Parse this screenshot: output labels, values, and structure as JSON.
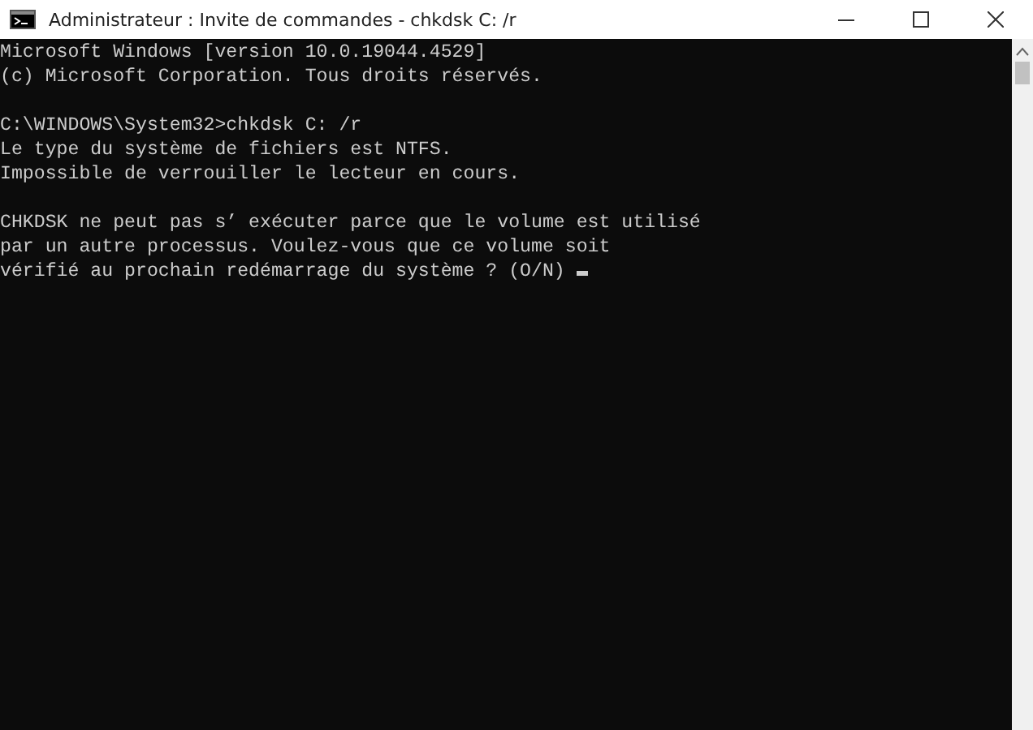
{
  "window": {
    "title": "Administrateur : Invite de commandes - chkdsk  C: /r"
  },
  "console": {
    "blocks": [
      [
        "Microsoft Windows [version 10.0.19044.4529]",
        "(c) Microsoft Corporation. Tous droits réservés."
      ],
      [
        "C:\\WINDOWS\\System32>chkdsk C: /r",
        "Le type du système de fichiers est NTFS.",
        "Impossible de verrouiller le lecteur en cours."
      ],
      [
        "CHKDSK ne peut pas s’ exécuter parce que le volume est utilisé",
        "par un autre processus. Voulez-vous que ce volume soit",
        "vérifié au prochain redémarrage du système ? (O/N)"
      ]
    ]
  }
}
